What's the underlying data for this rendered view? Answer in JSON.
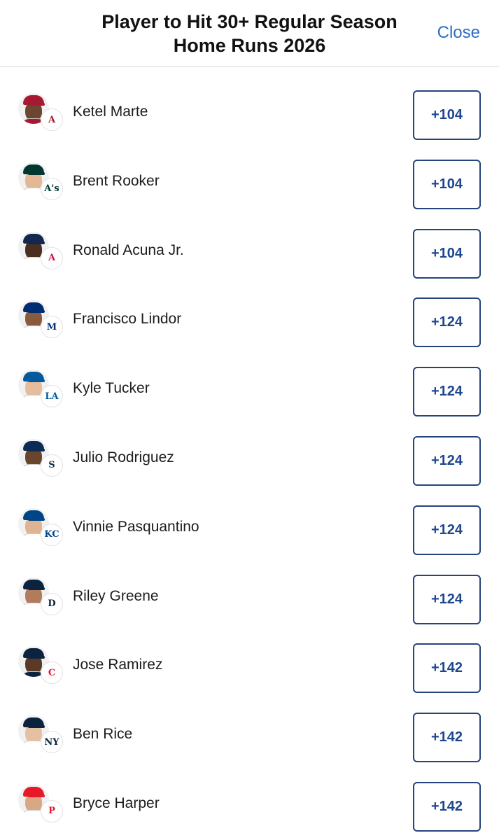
{
  "header": {
    "title_line1": "Player to Hit 30+ Regular Season",
    "title_line2": "Home Runs 2026",
    "close_label": "Close"
  },
  "colors": {
    "accent": "#2b6cc4",
    "odds_text": "#1e4790",
    "odds_border": "#24457a"
  },
  "players": [
    {
      "name": "Ketel Marte",
      "odds": "+104",
      "team_icon": "diamondbacks-logo-icon",
      "badge": "A",
      "badge_color": "#a71930",
      "cap": "#a71930",
      "skin": "#6b4632",
      "shirt": "#a71930"
    },
    {
      "name": "Brent Rooker",
      "odds": "+104",
      "team_icon": "athletics-logo-icon",
      "badge": "A's",
      "badge_color": "#003831",
      "cap": "#003831",
      "skin": "#e2b896",
      "shirt": "#ffffff"
    },
    {
      "name": "Ronald Acuna Jr.",
      "odds": "+104",
      "team_icon": "braves-logo-icon",
      "badge": "A",
      "badge_color": "#ce1141",
      "cap": "#13274f",
      "skin": "#4a2e1f",
      "shirt": "#ffffff"
    },
    {
      "name": "Francisco Lindor",
      "odds": "+124",
      "team_icon": "mets-logo-icon",
      "badge": "M",
      "badge_color": "#002d72",
      "cap": "#002d72",
      "skin": "#8a5a3c",
      "shirt": "#ffffff"
    },
    {
      "name": "Kyle Tucker",
      "odds": "+124",
      "team_icon": "dodgers-logo-icon",
      "badge": "LA",
      "badge_color": "#005a9c",
      "cap": "#005a9c",
      "skin": "#e5bc9c",
      "shirt": "#ffffff"
    },
    {
      "name": "Julio Rodriguez",
      "odds": "+124",
      "team_icon": "mariners-logo-icon",
      "badge": "S",
      "badge_color": "#0c2c56",
      "cap": "#0c2c56",
      "skin": "#6a452e",
      "shirt": "#ffffff"
    },
    {
      "name": "Vinnie Pasquantino",
      "odds": "+124",
      "team_icon": "royals-logo-icon",
      "badge": "KC",
      "badge_color": "#004687",
      "cap": "#004687",
      "skin": "#e0b492",
      "shirt": "#ffffff"
    },
    {
      "name": "Riley Greene",
      "odds": "+124",
      "team_icon": "tigers-logo-icon",
      "badge": "D",
      "badge_color": "#0c2340",
      "cap": "#0c2340",
      "skin": "#b07c5c",
      "shirt": "#ffffff"
    },
    {
      "name": "Jose Ramirez",
      "odds": "+142",
      "team_icon": "guardians-logo-icon",
      "badge": "C",
      "badge_color": "#e31937",
      "cap": "#0c2340",
      "skin": "#5a3a26",
      "shirt": "#0c2340"
    },
    {
      "name": "Ben Rice",
      "odds": "+142",
      "team_icon": "yankees-logo-icon",
      "badge": "NY",
      "badge_color": "#0c2340",
      "cap": "#0c2340",
      "skin": "#e6c0a2",
      "shirt": "#ffffff"
    },
    {
      "name": "Bryce Harper",
      "odds": "+142",
      "team_icon": "phillies-logo-icon",
      "badge": "P",
      "badge_color": "#e81828",
      "cap": "#e81828",
      "skin": "#d8a886",
      "shirt": "#ffffff"
    }
  ]
}
